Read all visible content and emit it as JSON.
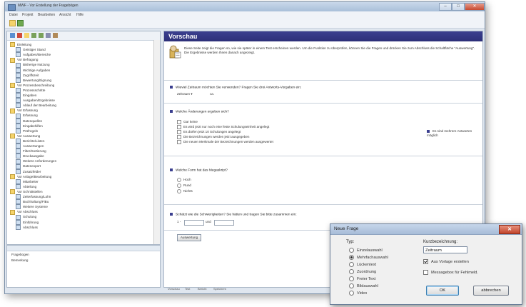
{
  "main_window": {
    "title": "MWF - Vor Erstellung der Fragebögen",
    "menu": [
      "Datei",
      "Projekt",
      "Bearbeiten",
      "Ansicht",
      "Hilfe"
    ],
    "controls": [
      "–",
      "□",
      "✕"
    ]
  },
  "tree": {
    "items": [
      {
        "label": "Einleitung",
        "kind": "folder",
        "level": 0
      },
      {
        "label": "Geistiger Stand",
        "kind": "q",
        "level": 1
      },
      {
        "label": "Aufgaben/Bereiche",
        "kind": "q",
        "level": 1
      },
      {
        "label": "Vor Befragung",
        "kind": "folder",
        "level": 0
      },
      {
        "label": "Bisherige Nutzung",
        "kind": "q",
        "level": 1
      },
      {
        "label": "Wichtige Aufgaben",
        "kind": "q",
        "level": 1
      },
      {
        "label": "Zugriffszeit",
        "kind": "q",
        "level": 1
      },
      {
        "label": "Bewertung/Eignung",
        "kind": "q",
        "level": 1
      },
      {
        "label": "Vor Prozessbeschreibung",
        "kind": "folder",
        "level": 0
      },
      {
        "label": "Prozessschritte",
        "kind": "q",
        "level": 1
      },
      {
        "label": "Eingaben",
        "kind": "q",
        "level": 1
      },
      {
        "label": "Ausgaben/Ergebnisse",
        "kind": "q",
        "level": 1
      },
      {
        "label": "Ablauf der Bearbeitung",
        "kind": "q",
        "level": 1
      },
      {
        "label": "Vor Erfassung",
        "kind": "folder",
        "level": 0
      },
      {
        "label": "Erfassung",
        "kind": "q",
        "level": 1
      },
      {
        "label": "Datenquellen",
        "kind": "q",
        "level": 1
      },
      {
        "label": "Eingabehilfen",
        "kind": "q",
        "level": 1
      },
      {
        "label": "Prüfregeln",
        "kind": "q",
        "level": 1
      },
      {
        "label": "Vor Auswertung",
        "kind": "folder",
        "level": 0
      },
      {
        "label": "Berichte/Listen",
        "kind": "q",
        "level": 1
      },
      {
        "label": "Auswertungen",
        "kind": "q",
        "level": 1
      },
      {
        "label": "Filter/Sortierung",
        "kind": "q",
        "level": 1
      },
      {
        "label": "Druckausgabe",
        "kind": "q",
        "level": 1
      },
      {
        "label": "Weitere Anforderungen",
        "kind": "q",
        "level": 1
      },
      {
        "label": "Datenexport",
        "kind": "q",
        "level": 1
      },
      {
        "label": "Zusatzfelder",
        "kind": "q",
        "level": 1
      },
      {
        "label": "Vor Anlage/Bearbeitung",
        "kind": "folder",
        "level": 0
      },
      {
        "label": "Mitarbeiter",
        "kind": "q",
        "level": 1
      },
      {
        "label": "Abteilung",
        "kind": "q",
        "level": 1
      },
      {
        "label": "Vor Schnittstellen",
        "kind": "folder",
        "level": 0
      },
      {
        "label": "Zeiterfassung/Lohn",
        "kind": "q",
        "level": 1
      },
      {
        "label": "Buchhaltung/FiBu",
        "kind": "q",
        "level": 1
      },
      {
        "label": "Weitere Systeme",
        "kind": "q",
        "level": 1
      },
      {
        "label": "Vor Abschluss",
        "kind": "folder",
        "level": 0
      },
      {
        "label": "Schulung",
        "kind": "q",
        "level": 1
      },
      {
        "label": "Einführung",
        "kind": "q",
        "level": 1
      },
      {
        "label": "Abschluss",
        "kind": "q",
        "level": 1
      }
    ]
  },
  "lower_pane": {
    "header": "Eigenschaften",
    "items": [
      "Fragebogen",
      "Bemerkung"
    ]
  },
  "preview": {
    "title": "Vorschau",
    "info": "Diese Seite zeigt die Fragen so, wie sie später in einem Test erscheinen werden. Um die Funktion zu überprüfen, können Sie die Fragen und drücken Sie zum Abschluss die Schaltfläche \"Auswertung\". Die Ergebnisse werden Ihnen danach angezeigt.",
    "q1": {
      "text": "Wieviel Zeitraum möchten Sie verwenden? Fragen Sie drei Antworts-Vorgaben ein:",
      "value_label": "Zeitraum ▾",
      "value": "ca."
    },
    "q2": {
      "text": "Welche Änderungen ergeben sich?",
      "options": [
        "Gar keine",
        "Es wird jetzt nur noch eine feste Schulungseinheit angelegt",
        "Es dürfen jetzt 10 Schulungen angelegt",
        "Die Bezeichnungen werden jetzt ausgegeben",
        "Die neuen Merkmale der Bezeichnungen werden ausgewertet"
      ],
      "side_note": "Es sind mehrere Antworten möglich"
    },
    "q3": {
      "text": "Welche Form hat das Megaskript?",
      "options": [
        "Hoch",
        "Rund",
        "Nichts"
      ]
    },
    "q4": {
      "text": "Schätzt wie die Schwierigkeiten? Sie hätten und tragen Sie bitte zusammen ein:",
      "prefix": "1 -",
      "suffix": "und"
    },
    "button": "Auswertung",
    "status": [
      "Vorschau",
      "Test",
      "Bericht",
      "Speichern"
    ]
  },
  "dialog": {
    "title": "Neue Frage",
    "type_label": "Typ:",
    "type_options": [
      "Einzelauswahl",
      "Mehrfachauswahl",
      "Lückentext",
      "Zuordnung",
      "Freier Text",
      "Bildauswahl",
      "Video"
    ],
    "selected_type": "Mehrfachauswahl",
    "short_label": "Kurzbezeichnung:",
    "short_value": "Zeitraum",
    "check1": "Aus Vorlage erstellen",
    "check1_on": true,
    "check2": "Messagebox für Fehlmeld.",
    "check2_on": false,
    "ok": "OK",
    "cancel": "abbrechen"
  },
  "colors": {
    "preview_header": "#3b3f8f",
    "title_bar": "#a9bfd9",
    "close_red": "#c1432a"
  }
}
